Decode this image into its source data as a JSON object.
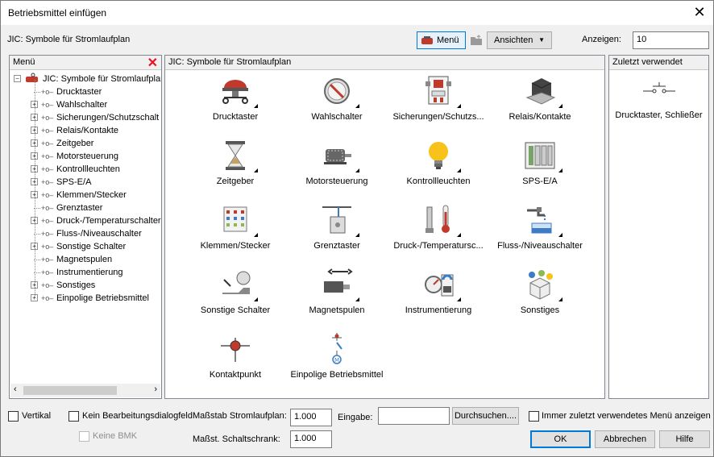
{
  "window": {
    "title": "Betriebsmittel einfügen"
  },
  "toolbar": {
    "context_label": "JIC: Symbole für Stromlaufplan",
    "menu_button": "Menü",
    "views_button": "Ansichten",
    "show_label": "Anzeigen:",
    "show_value": "10"
  },
  "menu_panel": {
    "title": "Menü",
    "root": "JIC: Symbole für Stromlaufplan",
    "items": [
      {
        "label": "Drucktaster",
        "expandable": false
      },
      {
        "label": "Wahlschalter",
        "expandable": true
      },
      {
        "label": "Sicherungen/Schutzschalt",
        "expandable": true
      },
      {
        "label": "Relais/Kontakte",
        "expandable": true
      },
      {
        "label": "Zeitgeber",
        "expandable": true
      },
      {
        "label": "Motorsteuerung",
        "expandable": true
      },
      {
        "label": "Kontrollleuchten",
        "expandable": true
      },
      {
        "label": "SPS-E/A",
        "expandable": true
      },
      {
        "label": "Klemmen/Stecker",
        "expandable": true
      },
      {
        "label": "Grenztaster",
        "expandable": false
      },
      {
        "label": "Druck-/Temperaturschalter",
        "expandable": true
      },
      {
        "label": "Fluss-/Niveauschalter",
        "expandable": false
      },
      {
        "label": "Sonstige Schalter",
        "expandable": true
      },
      {
        "label": "Magnetspulen",
        "expandable": false
      },
      {
        "label": "Instrumentierung",
        "expandable": false
      },
      {
        "label": "Sonstiges",
        "expandable": true
      },
      {
        "label": "Einpolige Betriebsmittel",
        "expandable": true
      }
    ]
  },
  "center_panel": {
    "title": "JIC: Symbole für Stromlaufplan",
    "tiles": [
      {
        "label": "Drucktaster",
        "icon": "pushbutton-icon"
      },
      {
        "label": "Wahlschalter",
        "icon": "selector-switch-icon"
      },
      {
        "label": "Sicherungen/Schutzs...",
        "icon": "fuse-icon"
      },
      {
        "label": "Relais/Kontakte",
        "icon": "relay-icon"
      },
      {
        "label": "Zeitgeber",
        "icon": "hourglass-icon"
      },
      {
        "label": "Motorsteuerung",
        "icon": "motor-icon"
      },
      {
        "label": "Kontrollleuchten",
        "icon": "lightbulb-icon"
      },
      {
        "label": "SPS-E/A",
        "icon": "plc-icon"
      },
      {
        "label": "Klemmen/Stecker",
        "icon": "terminal-icon"
      },
      {
        "label": "Grenztaster",
        "icon": "limit-switch-icon"
      },
      {
        "label": "Druck-/Temperatursc...",
        "icon": "thermometer-icon"
      },
      {
        "label": "Fluss-/Niveauschalter",
        "icon": "flow-switch-icon"
      },
      {
        "label": "Sonstige Schalter",
        "icon": "misc-switch-icon"
      },
      {
        "label": "Magnetspulen",
        "icon": "solenoid-icon"
      },
      {
        "label": "Instrumentierung",
        "icon": "gauge-icon"
      },
      {
        "label": "Sonstiges",
        "icon": "misc-icon"
      },
      {
        "label": "Kontaktpunkt",
        "icon": "contact-point-icon"
      },
      {
        "label": "Einpolige Betriebsmittel",
        "icon": "single-line-icon"
      }
    ]
  },
  "recent_panel": {
    "title": "Zuletzt verwendet",
    "items": [
      {
        "label": "Drucktaster, Schließer",
        "icon": "normally-open-contact-icon"
      }
    ]
  },
  "footer": {
    "vertical": "Vertikal",
    "no_edit_dialog": "Kein Bearbeitungsdialogfeld",
    "no_bom": "Keine BMK",
    "scale_schematic_label": "Maßstab Stromlaufplan:",
    "scale_schematic_value": "1.000",
    "scale_panel_label": "Maßst. Schaltschrank:",
    "scale_panel_value": "1.000",
    "input_label": "Eingabe:",
    "input_value": "",
    "browse_button": "Durchsuchen....",
    "always_last_menu": "Immer zuletzt verwendetes Menü anzeigen",
    "ok_button": "OK",
    "cancel_button": "Abbrechen",
    "help_button": "Hilfe"
  },
  "colors": {
    "accent": "#0078d7",
    "close_red": "#e81123",
    "icon_red": "#c0392b"
  }
}
